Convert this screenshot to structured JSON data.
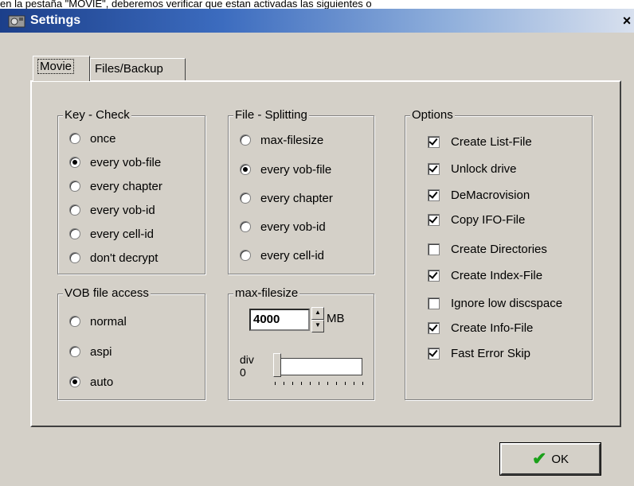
{
  "caption": "en la pestaña \"MOVIE\", deberemos verificar que estan activadas las siguientes o",
  "window": {
    "title": "Settings",
    "close": "×"
  },
  "tabs": [
    {
      "label": "Movie"
    },
    {
      "label": "Files/Backup"
    }
  ],
  "key_check": {
    "title": "Key - Check",
    "options": [
      {
        "label": "once",
        "selected": false
      },
      {
        "label": "every vob-file",
        "selected": true
      },
      {
        "label": "every chapter",
        "selected": false
      },
      {
        "label": "every vob-id",
        "selected": false
      },
      {
        "label": "every cell-id",
        "selected": false
      },
      {
        "label": "don't decrypt",
        "selected": false
      }
    ]
  },
  "file_splitting": {
    "title": "File - Splitting",
    "options": [
      {
        "label": "max-filesize",
        "selected": false
      },
      {
        "label": "every vob-file",
        "selected": true
      },
      {
        "label": "every chapter",
        "selected": false
      },
      {
        "label": "every vob-id",
        "selected": false
      },
      {
        "label": "every cell-id",
        "selected": false
      }
    ]
  },
  "vob_access": {
    "title": "VOB file access",
    "options": [
      {
        "label": "normal",
        "selected": false
      },
      {
        "label": "aspi",
        "selected": false
      },
      {
        "label": "auto",
        "selected": true
      }
    ]
  },
  "max_filesize": {
    "title": "max-filesize",
    "value": "4000",
    "unit": "MB",
    "slider_label_1": "div",
    "slider_label_2": "0",
    "slider_value": 0
  },
  "options": {
    "title": "Options",
    "items": [
      {
        "label": "Create List-File",
        "checked": true
      },
      {
        "label": "Unlock drive",
        "checked": true
      },
      {
        "label": "DeMacrovision",
        "checked": true
      },
      {
        "label": "Copy IFO-File",
        "checked": true
      },
      {
        "label": "Create Directories",
        "checked": false
      },
      {
        "label": "Create Index-File",
        "checked": true
      },
      {
        "label": "Ignore low discspace",
        "checked": false
      },
      {
        "label": "Create Info-File",
        "checked": true
      },
      {
        "label": "Fast Error Skip",
        "checked": true
      }
    ]
  },
  "ok_button": {
    "label": "OK",
    "icon": "checkmark-icon",
    "icon_color": "#1aa01a"
  }
}
